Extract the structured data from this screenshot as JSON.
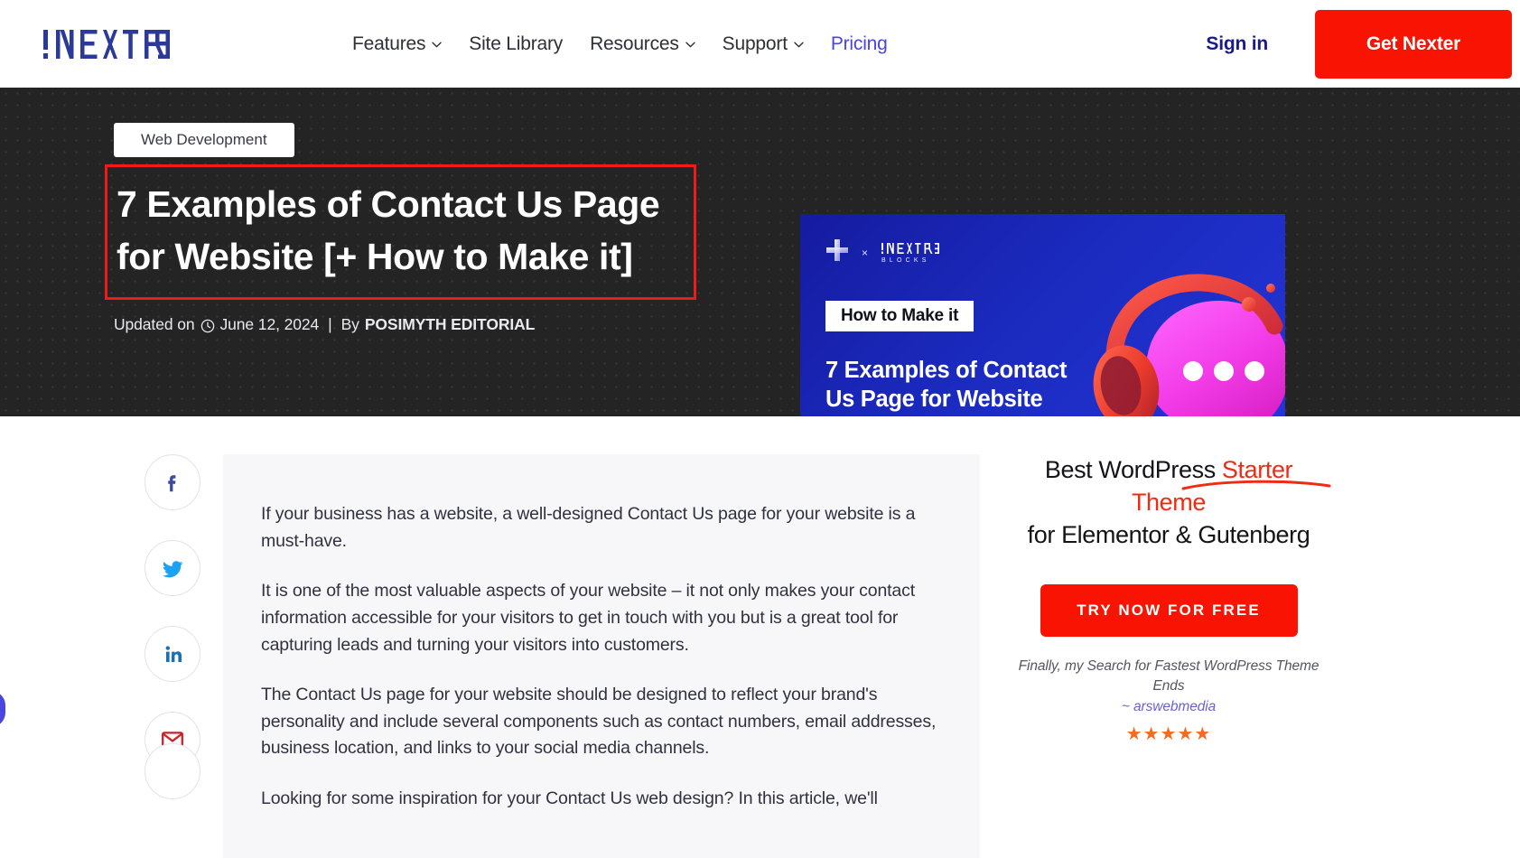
{
  "header": {
    "logo_text": "NEXTER",
    "nav": [
      {
        "label": "Features",
        "has_dropdown": true,
        "accent": false
      },
      {
        "label": "Site Library",
        "has_dropdown": false,
        "accent": false
      },
      {
        "label": "Resources",
        "has_dropdown": true,
        "accent": false
      },
      {
        "label": "Support",
        "has_dropdown": true,
        "accent": false
      },
      {
        "label": "Pricing",
        "has_dropdown": false,
        "accent": true
      }
    ],
    "signin_label": "Sign in",
    "cta_label": "Get Nexter",
    "cta_color": "#f91302",
    "accent_color": "#4a46e0"
  },
  "hero": {
    "category_badge": "Web Development",
    "title_line1": "7 Examples of Contact Us Page",
    "title_line2": "for Website [+ How to Make it]",
    "highlight_box_color": "#ef1a1a",
    "meta": {
      "updated_prefix": "Updated on",
      "clock_icon": "clock-icon",
      "date": "June 12, 2024",
      "separator": "|",
      "by_prefix": "By",
      "author": "POSIMYTH EDITORIAL"
    },
    "background_color": "#242424"
  },
  "feature_card": {
    "brand_left_icon": "elementor-logo-icon",
    "brand_x": "×",
    "brand_right": "NEXTER",
    "brand_right_sub": "BLOCKS",
    "badge": "How to Make it",
    "title_line1": "7 Examples of Contact",
    "title_line2": "Us Page for Website",
    "illustration": "headphones-chat-bubble-3d-illustration",
    "bg_start": "#151ba0",
    "bg_end": "#2335d8"
  },
  "share": {
    "items": [
      {
        "name": "facebook",
        "glyph": "f",
        "color": "#3b4a9c"
      },
      {
        "name": "twitter",
        "glyph": "bird",
        "color": "#1da1f2"
      },
      {
        "name": "linkedin",
        "glyph": "in",
        "color": "#1c6fb3"
      },
      {
        "name": "email",
        "glyph": "envelope",
        "color": "#cc2127"
      }
    ]
  },
  "article": {
    "paragraphs": [
      "If your business has a website, a well-designed Contact Us page for your website is a must-have.",
      "It is one of the most valuable aspects of your website – it not only makes your contact information accessible for your visitors to get in touch with you but is a great tool for capturing leads and turning your visitors into customers.",
      "The Contact Us page for your website should be designed to reflect your brand's personality and include several components such as contact numbers, email addresses, business location, and links to your social media channels.",
      "Looking for some inspiration for your Contact Us web design? In this article, we'll"
    ]
  },
  "promo": {
    "head_prefix": "Best WordPress ",
    "head_highlight": "Starter Theme",
    "head_line2": "for Elementor & Gutenberg",
    "highlight_color": "#ee2b14",
    "button_label": "TRY NOW FOR FREE",
    "button_color": "#f91302",
    "quote": "Finally, my Search for Fastest WordPress Theme Ends",
    "author": "~ arswebmedia",
    "stars": "★★★★★",
    "star_color": "#f36a21"
  }
}
